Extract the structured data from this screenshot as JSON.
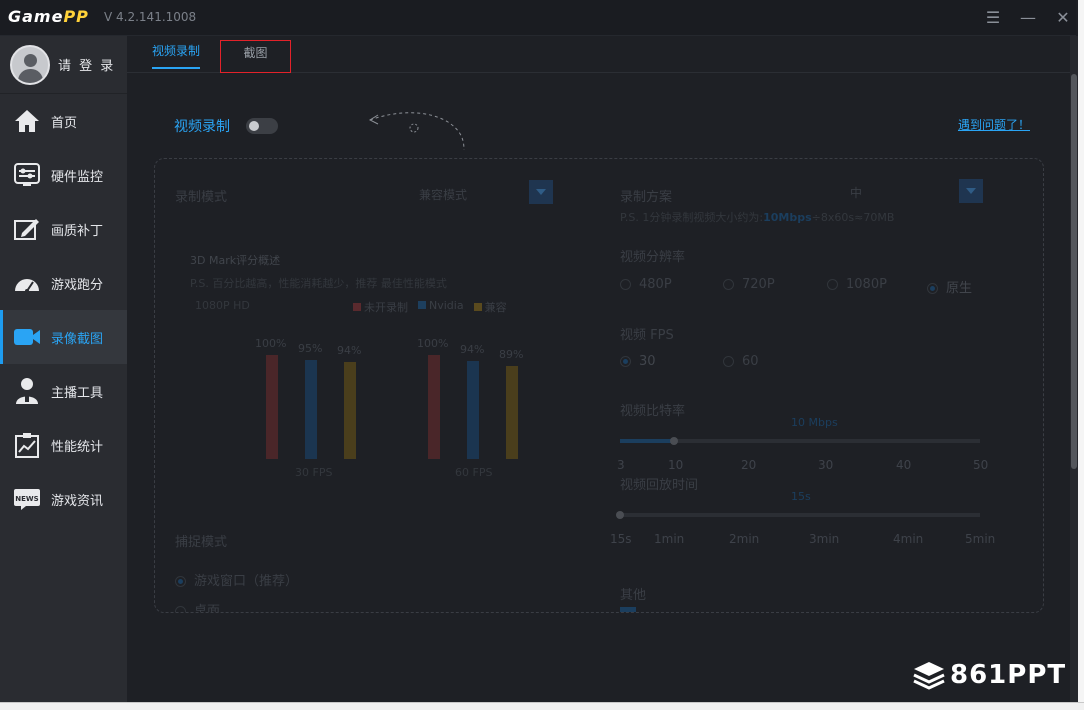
{
  "app": {
    "logo_a": "Game",
    "logo_b": "PP",
    "version": "V 4.2.141.1008"
  },
  "window": {
    "menu_icon": "hamburger-icon",
    "minimize_icon": "minimize-icon",
    "close_icon": "close-icon"
  },
  "user": {
    "login_label": "请 登 录"
  },
  "sidebar": {
    "items": [
      {
        "label": "首页",
        "icon": "home-icon"
      },
      {
        "label": "硬件监控",
        "icon": "hardware-monitor-icon"
      },
      {
        "label": "画质补丁",
        "icon": "quality-patch-icon"
      },
      {
        "label": "游戏跑分",
        "icon": "speedometer-icon"
      },
      {
        "label": "录像截图",
        "icon": "video-camera-icon"
      },
      {
        "label": "主播工具",
        "icon": "streamer-icon"
      },
      {
        "label": "性能统计",
        "icon": "performance-chart-icon"
      },
      {
        "label": "游戏资讯",
        "icon": "news-icon"
      }
    ],
    "active_index": 4
  },
  "tabs": [
    {
      "label": "视频录制"
    },
    {
      "label": "截图"
    }
  ],
  "recording": {
    "toggle_label": "视频录制",
    "toggle_on": false,
    "help_link": "遇到问题了！"
  },
  "left_panel": {
    "mode_label": "录制模式",
    "mode_value": "兼容模式",
    "benchmark_title": "3D Mark评分概述",
    "benchmark_sub": "P.S. 百分比越高，性能消耗越少，推荐 最佳性能模式",
    "res_label": "1080P HD",
    "legend": [
      {
        "name": "未开录制",
        "color": "#5a2a2e"
      },
      {
        "name": "Nvidia",
        "color": "#1d3f5e"
      },
      {
        "name": "兼容",
        "color": "#5a4a1e"
      }
    ],
    "groups": [
      {
        "label": "30 FPS",
        "values": [
          "100%",
          "95%",
          "94%"
        ]
      },
      {
        "label": "60 FPS",
        "values": [
          "100%",
          "94%",
          "89%"
        ]
      }
    ],
    "capture_label": "捕捉模式",
    "capture_option_1": "游戏窗口（推荐）",
    "capture_option_2": "桌面"
  },
  "right_panel": {
    "scheme_label": "录制方案",
    "scheme_value": "中",
    "scheme_note_a": "P.S. 1分钟录制视频大小约为:",
    "scheme_note_b": "10Mbps",
    "scheme_note_c": "÷8x60s≈70MB",
    "resolution_label": "视频分辨率",
    "resolutions": [
      "480P",
      "720P",
      "1080P",
      "原生"
    ],
    "resolution_selected": 3,
    "fps_label": "视频 FPS",
    "fps_options": [
      "30",
      "60"
    ],
    "fps_selected": 0,
    "bitrate_label": "视频比特率",
    "bitrate_value": "10 Mbps",
    "bitrate_ticks": [
      "3",
      "10",
      "20",
      "30",
      "40",
      "50"
    ],
    "bitrate_level": 10,
    "replay_label": "视频回放时间",
    "replay_value": "15s",
    "replay_ticks": [
      "15s",
      "1min",
      "2min",
      "3min",
      "4min",
      "5min"
    ],
    "other_label": "其他"
  },
  "watermark": "861PPT"
}
